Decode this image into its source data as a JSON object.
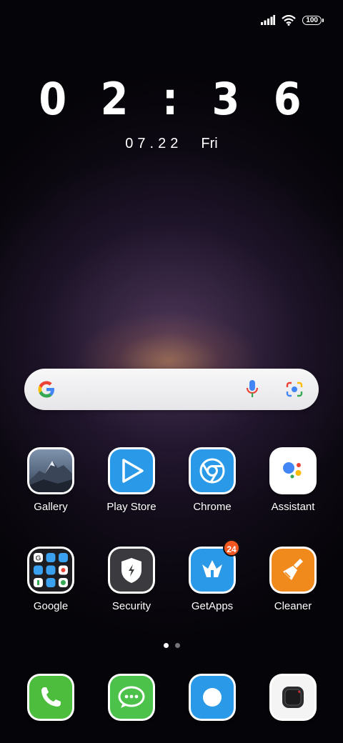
{
  "status_bar": {
    "battery": "100"
  },
  "lock_clock": {
    "time": "0 2 : 3 6",
    "date": "07.22",
    "weekday": "Fri"
  },
  "search_bar": {
    "icons": [
      "google-g-icon",
      "microphone-icon",
      "lens-camera-icon"
    ]
  },
  "apps": [
    {
      "label": "Gallery"
    },
    {
      "label": "Play Store"
    },
    {
      "label": "Chrome"
    },
    {
      "label": "Assistant"
    },
    {
      "label": "Google"
    },
    {
      "label": "Security"
    },
    {
      "label": "GetApps",
      "badge": "24"
    },
    {
      "label": "Cleaner"
    }
  ],
  "page_indicator": {
    "pages": 2,
    "current": 1
  },
  "dock": [
    "phone-icon",
    "messaging-icon",
    "browser-icon",
    "camera-icon"
  ],
  "colors": {
    "phone_green": "#4cbd3c",
    "message_green": "#4cc24a",
    "blue": "#2a9ae8",
    "orange": "#f08a1c"
  }
}
